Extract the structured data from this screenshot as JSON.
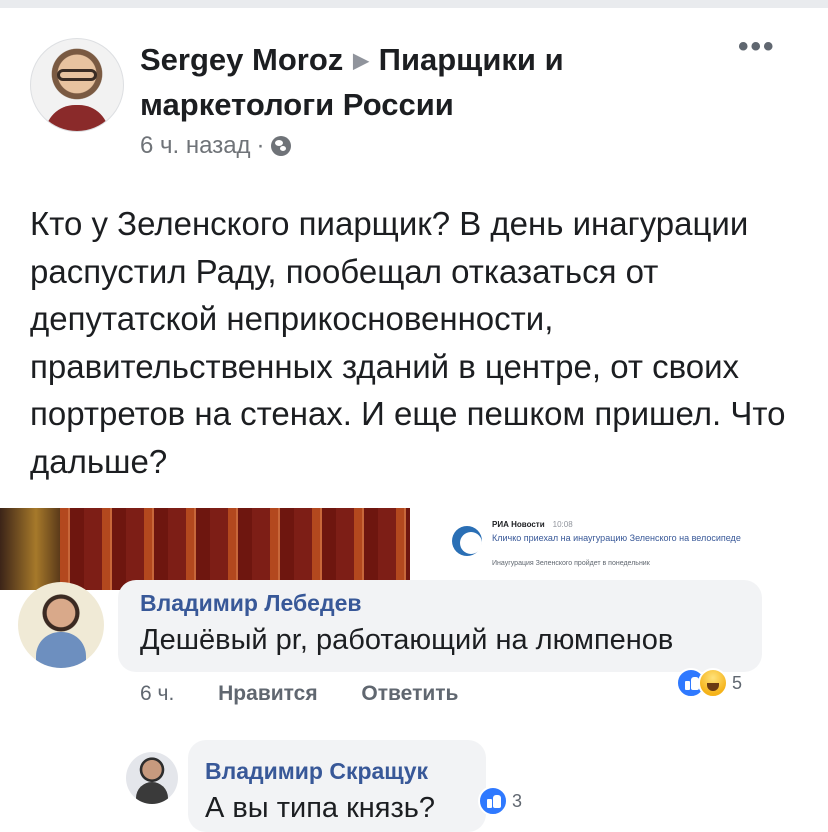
{
  "post": {
    "author": "Sergey Moroz",
    "group": "Пиарщики и маркетологи России",
    "time": "6 ч. назад",
    "separator": "·",
    "text": "Кто у Зеленского пиарщик? В день инагурации распустил Раду, пообещал отказаться от депутатской неприкосновенности, правительственных зданий в центре, от своих портретов на стенах. И еще пешком пришел. Что дальше?"
  },
  "preview": {
    "source": "РИА Новости",
    "time": "10:08",
    "headline": "Кличко приехал на инаугурацию Зеленского на велосипеде",
    "subtitle": "Инаугурация Зеленского пройдет в понедельник"
  },
  "comments": [
    {
      "author": "Владимир Лебедев",
      "text": "Дешёвый pr, работающий на люмпенов",
      "time": "6 ч.",
      "like_label": "Нравится",
      "reply_label": "Ответить",
      "reaction_count": "5"
    },
    {
      "author": "Владимир Скращук",
      "text": "А вы типа князь?",
      "reaction_count": "3"
    }
  ],
  "icons": {
    "privacy": "globe-icon",
    "menu": "more-icon",
    "reactions": [
      "like-icon",
      "haha-icon"
    ]
  },
  "colors": {
    "link_blue": "#385898",
    "like_blue": "#2f79ff",
    "bubble_gray": "#f2f3f5"
  }
}
